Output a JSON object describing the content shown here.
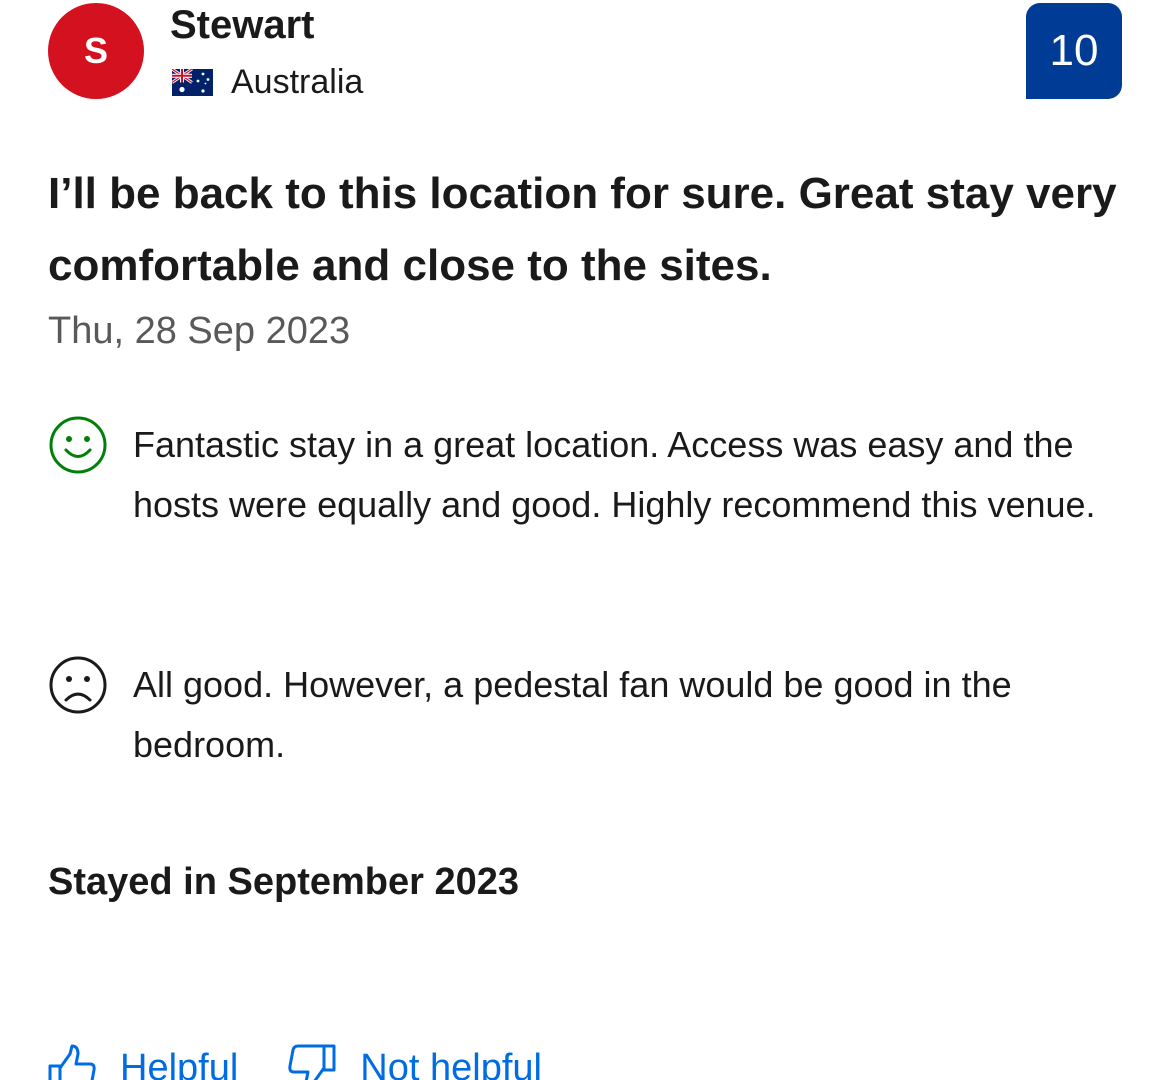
{
  "reviewer": {
    "initial": "S",
    "name": "Stewart",
    "country": "Australia",
    "flag_icon": "australia-flag-icon",
    "avatar_color": "#d4111e"
  },
  "score": {
    "value": "10",
    "color": "#003b95"
  },
  "review": {
    "title": "I’ll be back to this location for sure. Great stay very comfortable and close to the sites.",
    "date": "Thu, 28 Sep 2023",
    "positive": {
      "icon": "smiley-face-icon",
      "text": "Fantastic stay in a great location. Access was easy and the hosts were equally and good. Highly recommend this venue.",
      "color": "#008009"
    },
    "negative": {
      "icon": "sad-face-icon",
      "text": "All good. However, a pedestal fan would be good in the bedroom."
    },
    "stayed": "Stayed in September 2023"
  },
  "actions": {
    "helpful_label": "Helpful",
    "helpful_icon": "thumbs-up-icon",
    "not_helpful_label": "Not helpful",
    "not_helpful_icon": "thumbs-down-icon",
    "link_color": "#006ce4"
  }
}
